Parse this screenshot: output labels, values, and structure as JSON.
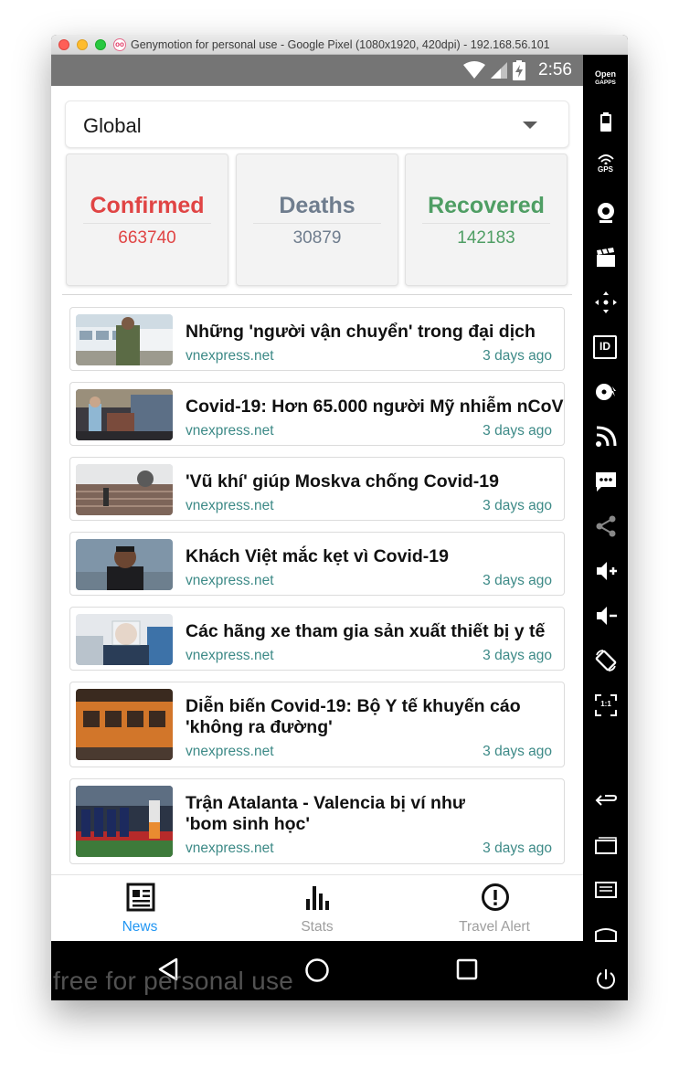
{
  "window": {
    "title": "Genymotion for personal use - Google Pixel (1080x1920, 420dpi) - 192.168.56.101",
    "logo_text": "oo"
  },
  "status_bar": {
    "time": "2:56"
  },
  "region_selector": {
    "value": "Global"
  },
  "stats": {
    "confirmed": {
      "label": "Confirmed",
      "value": "663740",
      "color": "#e04444"
    },
    "deaths": {
      "label": "Deaths",
      "value": "30879",
      "color": "#6f7d8e"
    },
    "recovered": {
      "label": "Recovered",
      "value": "142183",
      "color": "#4f9e64"
    }
  },
  "news": [
    {
      "title": "Những 'người vận chuyển' trong đại dịch",
      "source": "vnexpress.net",
      "time": "3 days ago",
      "thumb": "soldier-and-buses"
    },
    {
      "title": "Covid-19: Hơn 65.000 người Mỹ nhiễm nCoV",
      "source": "vnexpress.net",
      "time": "3 days ago",
      "thumb": "hospital-tent"
    },
    {
      "title": "'Vũ khí' giúp Moskva chống Covid-19",
      "source": "vnexpress.net",
      "time": "3 days ago",
      "thumb": "disinfection-stairs"
    },
    {
      "title": "Khách Việt mắc kẹt vì Covid-19",
      "source": "vnexpress.net",
      "time": "3 days ago",
      "thumb": "man-portrait"
    },
    {
      "title": "Các hãng xe tham gia sản xuất thiết bị y tế",
      "source": "vnexpress.net",
      "time": "3 days ago",
      "thumb": "face-shield-worker"
    },
    {
      "title_line1": "Diễn biến Covid-19: Bộ Y tế khuyến cáo",
      "title_line2": "'không ra đường'",
      "source": "vnexpress.net",
      "time": "3 days ago",
      "thumb": "orange-bus"
    },
    {
      "title_line1": "Trận Atalanta - Valencia bị ví như",
      "title_line2": "'bom sinh học'",
      "source": "vnexpress.net",
      "time": "3 days ago",
      "thumb": "football-team"
    }
  ],
  "bottom_nav": {
    "items": [
      {
        "label": "News",
        "icon": "newspaper-icon",
        "active": true
      },
      {
        "label": "Stats",
        "icon": "bar-chart-icon",
        "active": false
      },
      {
        "label": "Travel Alert",
        "icon": "alert-circle-icon",
        "active": false
      }
    ],
    "active_color": "#2196f3",
    "inactive_color": "#9e9e9e"
  },
  "watermark": "free for personal use",
  "genymotion_sidebar": {
    "open_gapps_line1": "Open",
    "open_gapps_line2": "GAPPS",
    "gps_label": "GPS",
    "id_label": "ID",
    "pixel_ratio_label": "1:1",
    "icons": [
      "open-gapps-icon",
      "battery-icon",
      "gps-icon",
      "webcam-icon",
      "screencast-icon",
      "remote-control-icon",
      "device-id-icon",
      "disk-io-icon",
      "network-icon",
      "phone-sms-icon",
      "share-icon",
      "volume-up-icon",
      "volume-down-icon",
      "rotate-icon",
      "pixel-perfect-icon",
      "back-icon",
      "recent-apps-icon",
      "menu-icon",
      "home-icon",
      "power-icon"
    ]
  }
}
